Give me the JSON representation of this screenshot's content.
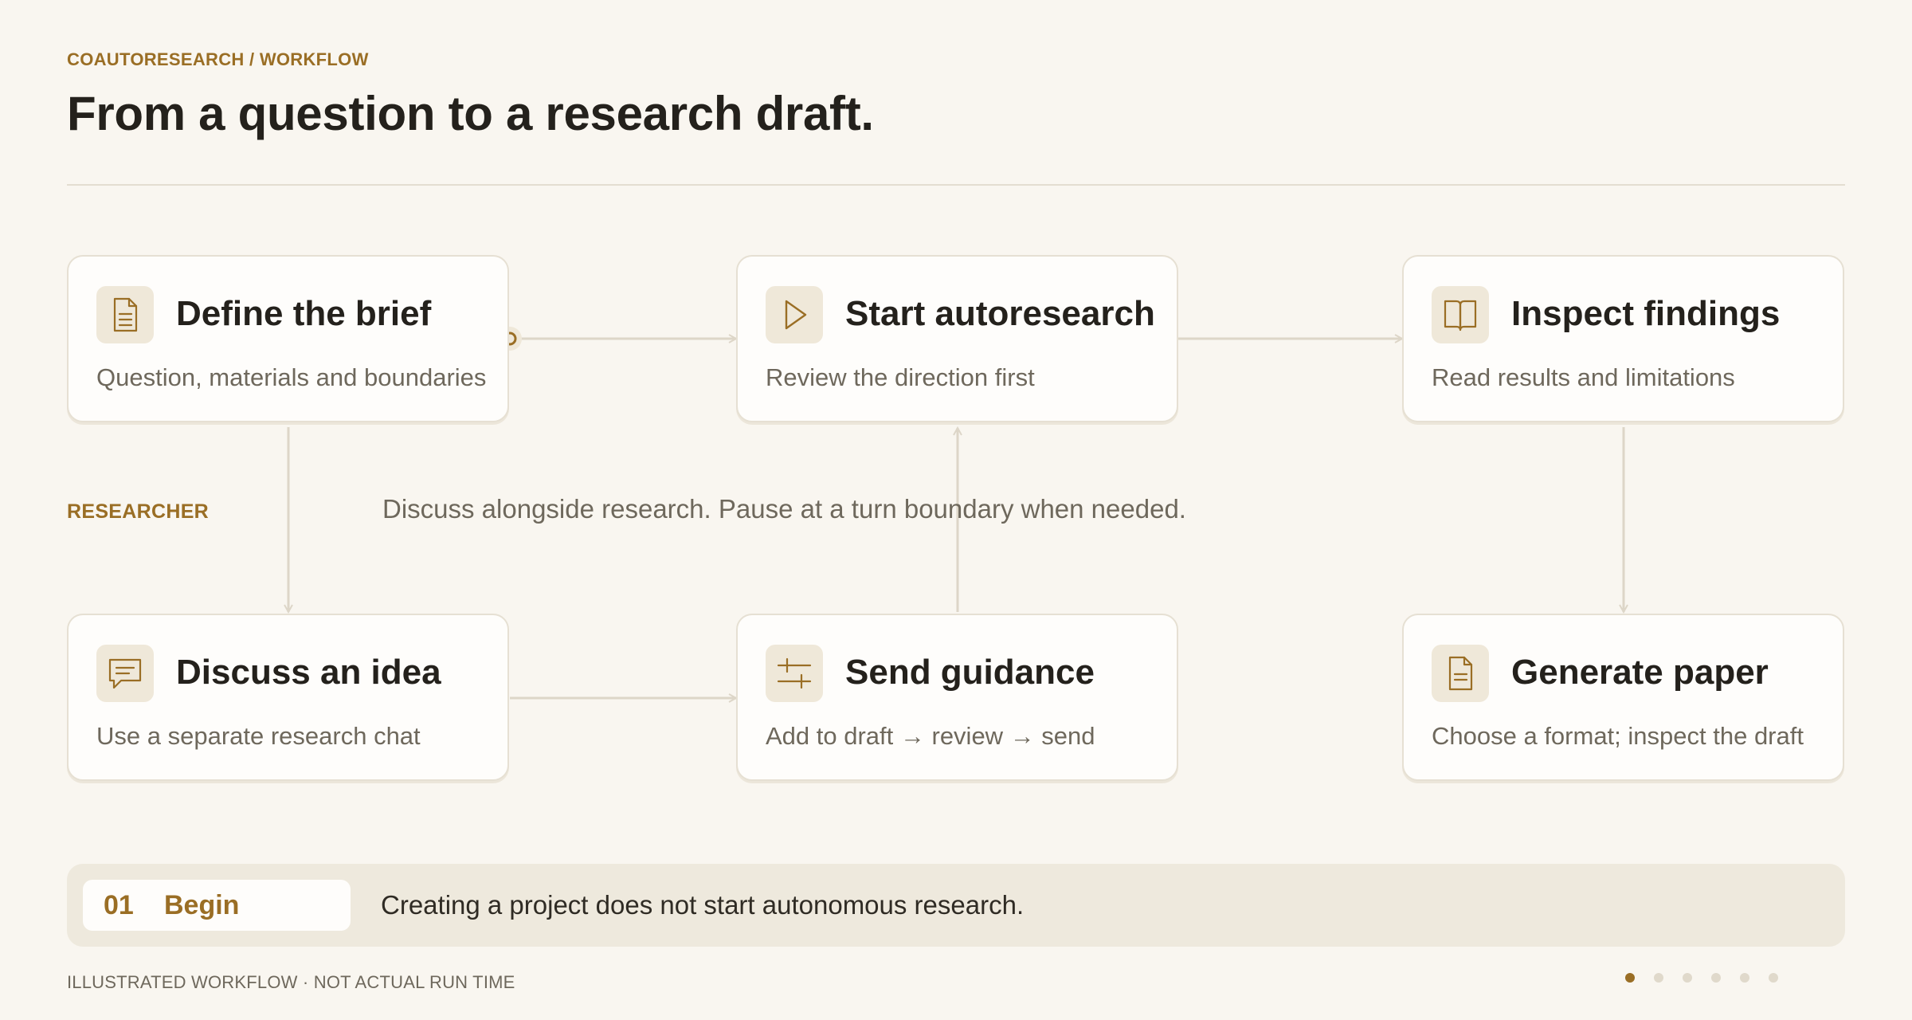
{
  "header": {
    "eyebrow": "COAUTORESEARCH / WORKFLOW",
    "title": "From a question to a research draft."
  },
  "cards": {
    "define": {
      "title": "Define the brief",
      "subtitle": "Question, materials and boundaries",
      "icon": "document-icon"
    },
    "start": {
      "title": "Start autoresearch",
      "subtitle": "Review the direction first",
      "icon": "play-icon"
    },
    "inspect": {
      "title": "Inspect findings",
      "subtitle": "Read results and limitations",
      "icon": "book-icon"
    },
    "discuss": {
      "title": "Discuss an idea",
      "subtitle": "Use a separate research chat",
      "icon": "chat-icon"
    },
    "guidance": {
      "title": "Send guidance",
      "subtitle": "Add to draft → review → send",
      "icon": "sliders-icon"
    },
    "paper": {
      "title": "Generate paper",
      "subtitle": "Choose a format; inspect the draft",
      "icon": "document-icon"
    }
  },
  "lane": {
    "role_label": "RESEARCHER",
    "note": "Discuss alongside research. Pause at a turn boundary when needed."
  },
  "step": {
    "number": "01",
    "label": "Begin",
    "description": "Creating a project does not start autonomous research."
  },
  "footer": {
    "note": "ILLUSTRATED WORKFLOW · NOT ACTUAL RUN TIME",
    "pagination": {
      "total": 6,
      "active": 1
    }
  },
  "colors": {
    "accent": "#9a6e25",
    "background": "#f9f6f0",
    "card": "#fefdfb",
    "connector": "#ddd6c8"
  }
}
